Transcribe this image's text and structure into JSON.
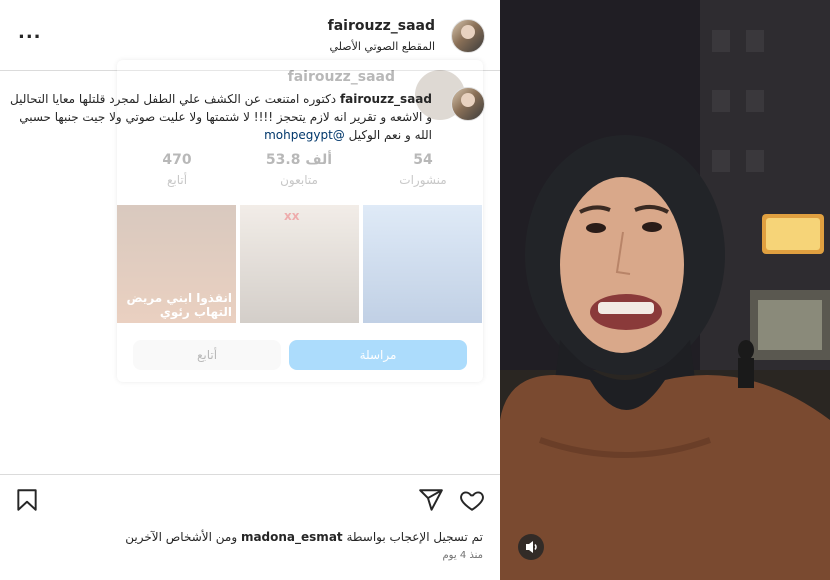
{
  "post": {
    "username": "fairouzz_saad",
    "audio_label": "المقطع الصوتي الأصلي",
    "more_label": "..."
  },
  "hover_card": {
    "username": "fairouzz_saad",
    "stats": [
      {
        "value": "470",
        "label": "أتابع"
      },
      {
        "value": "53.8 ألف",
        "label": "متابعون"
      },
      {
        "value": "54",
        "label": "منشورات"
      }
    ],
    "thumb_texts": [
      "انقذوا ابني مريض التهاب رئوي",
      "xx"
    ],
    "message_button": "مراسلة",
    "follow_button": "أتابع"
  },
  "caption": {
    "username": "fairouzz_saad",
    "text": "دكتوره امتنعت عن الكشف علي الطفل لمجرد قلتلها معايا التحاليل و الاشعه و تقرير انه لازم يتحجز !!!! لا شتمتها ولا عليت صوتي ولا جيت جنبها حسبي الله و نعم الوكيل",
    "mention": "@mohpegypt"
  },
  "likes": {
    "prefix": "تم تسجيل الإعجاب بواسطة",
    "user": "madona_esmat",
    "suffix": "ومن الأشخاص الآخرين"
  },
  "time_ago": "منذ 4 يوم",
  "colors": {
    "text": "#262626",
    "secondary": "#737373",
    "link": "#00376b",
    "divider": "#dbdbdb",
    "hover_button": "#0095f6"
  },
  "icons": [
    "more-icon",
    "heart-icon",
    "share-icon",
    "bookmark-icon",
    "volume-icon"
  ]
}
